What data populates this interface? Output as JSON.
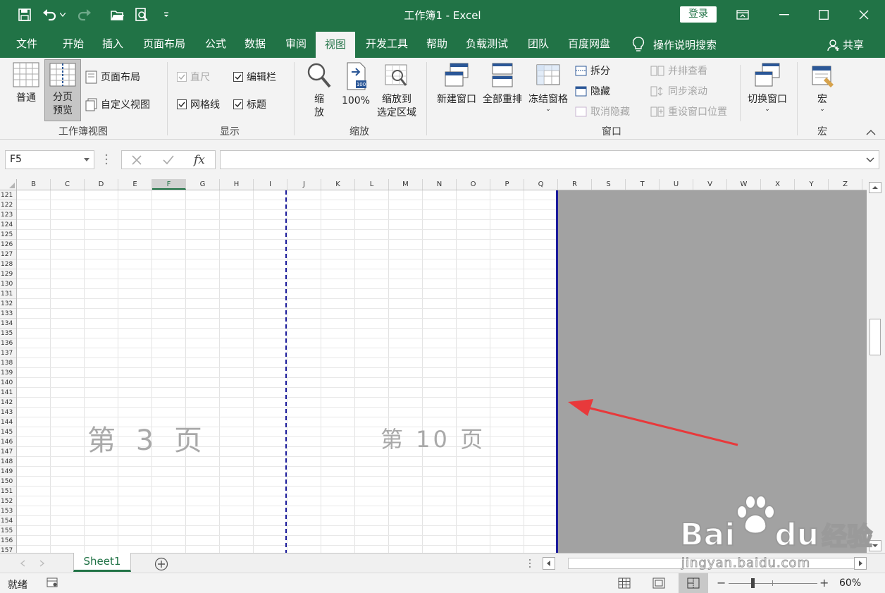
{
  "window": {
    "title": "工作簿1 - Excel",
    "login_label": "登录"
  },
  "tabs": [
    "文件",
    "开始",
    "插入",
    "页面布局",
    "公式",
    "数据",
    "审阅",
    "视图",
    "开发工具",
    "帮助",
    "负载测试",
    "团队",
    "百度网盘"
  ],
  "active_tab": "视图",
  "tell_me": "操作说明搜索",
  "share": "共享",
  "ribbon": {
    "workbook_views": {
      "label": "工作簿视图",
      "normal": "普通",
      "page_break_line1": "分页",
      "page_break_line2": "预览",
      "page_layout": "页面布局",
      "custom_views": "自定义视图"
    },
    "show": {
      "label": "显示",
      "ruler": "直尺",
      "formula_bar": "编辑栏",
      "gridlines": "网格线",
      "headings": "标题"
    },
    "zoom": {
      "label": "缩放",
      "zoom_line1": "缩",
      "zoom_line2": "放",
      "zoom100": "100%",
      "zoom_sel_line1": "缩放到",
      "zoom_sel_line2": "选定区域"
    },
    "window": {
      "label": "窗口",
      "new_window": "新建窗口",
      "arrange_all": "全部重排",
      "freeze_panes": "冻结窗格",
      "split": "拆分",
      "hide": "隐藏",
      "unhide": "取消隐藏",
      "side_by_side": "并排查看",
      "sync_scroll": "同步滚动",
      "reset_position": "重设窗口位置",
      "switch_windows": "切换窗口"
    },
    "macros": {
      "label": "宏",
      "macros": "宏"
    }
  },
  "namebox": "F5",
  "fx": "fx",
  "columns": [
    "B",
    "C",
    "D",
    "E",
    "F",
    "G",
    "H",
    "I",
    "J",
    "K",
    "L",
    "M",
    "N",
    "O",
    "P",
    "Q",
    "R",
    "S",
    "T",
    "U",
    "V",
    "W",
    "X",
    "Y",
    "Z"
  ],
  "selected_column": "F",
  "rows": [
    "121",
    "122",
    "123",
    "124",
    "125",
    "126",
    "127",
    "128",
    "129",
    "130",
    "131",
    "132",
    "133",
    "134",
    "135",
    "136",
    "137",
    "138",
    "139",
    "140",
    "141",
    "142",
    "143",
    "144",
    "145",
    "146",
    "147",
    "148",
    "149",
    "150",
    "151",
    "152",
    "153",
    "154",
    "155",
    "156",
    "157"
  ],
  "page_labels": {
    "left": "第 3 页",
    "right": "第 10 页"
  },
  "sheet_tab": "Sheet1",
  "status": {
    "ready": "就绪",
    "zoom": "60%"
  },
  "watermark": {
    "brand": "Bai",
    "brand2": "du",
    "cn": "经验",
    "url": "jingyan.baidu.com"
  },
  "colors": {
    "excel_green": "#217346",
    "page_break": "#1c1c9c",
    "annotation_arrow": "#e8393b"
  }
}
